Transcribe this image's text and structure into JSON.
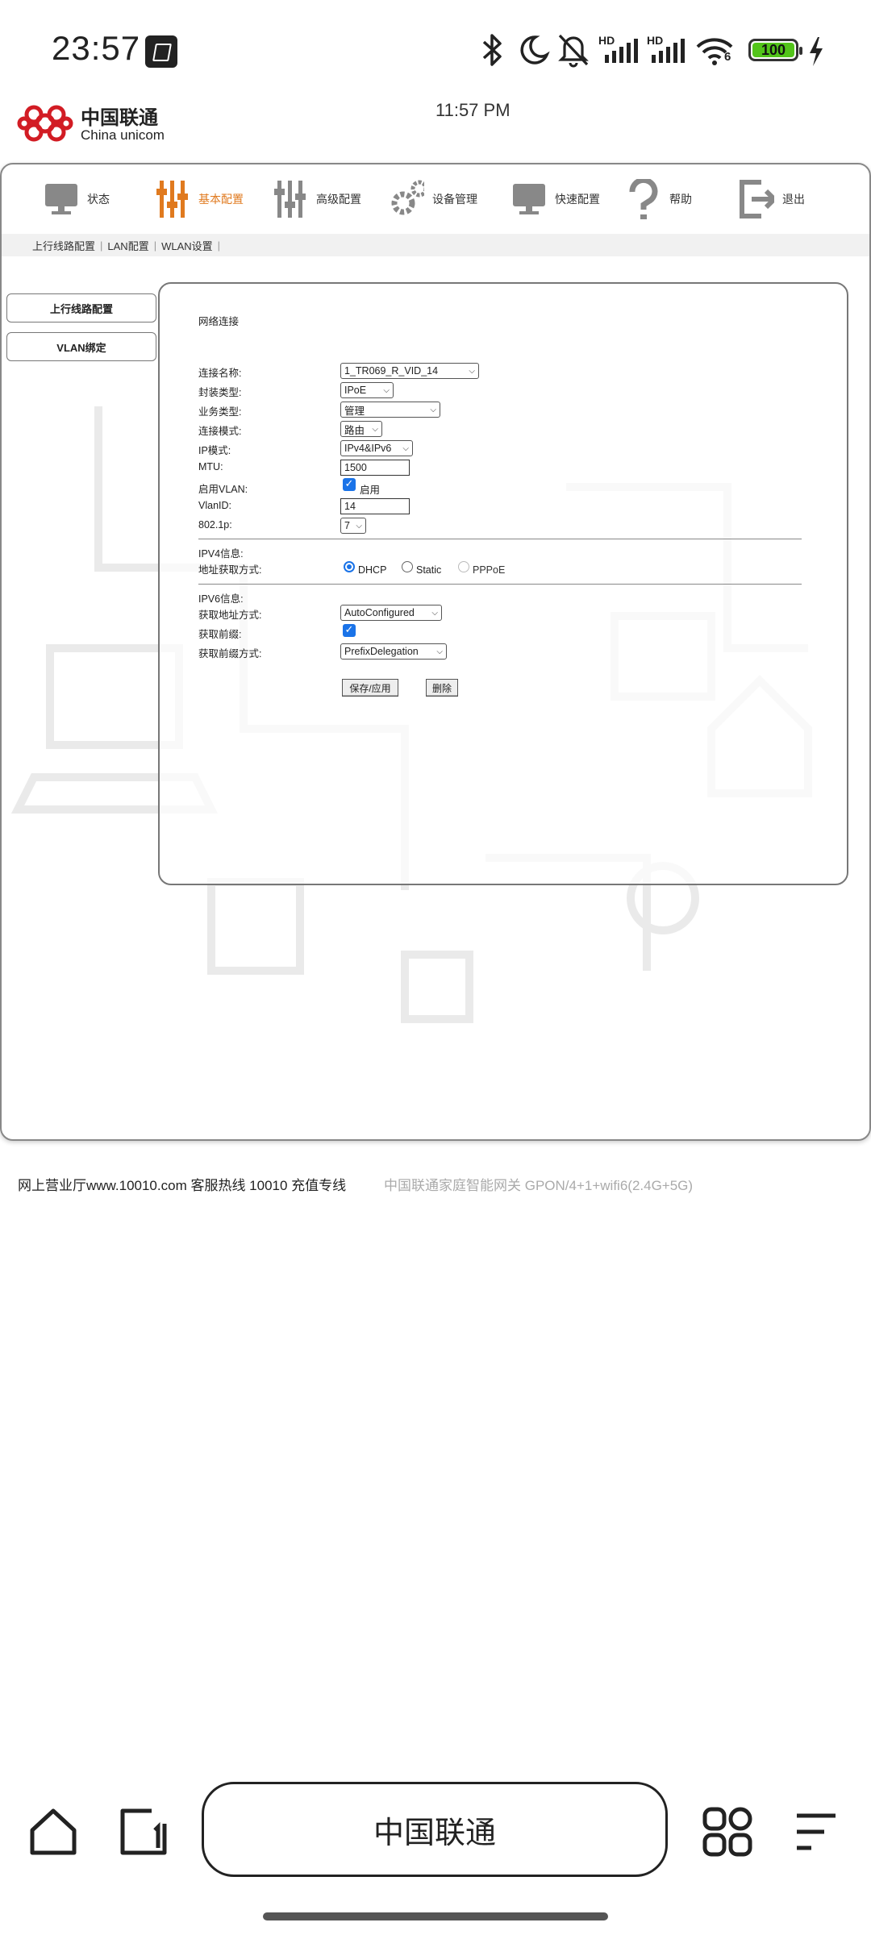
{
  "status_bar": {
    "time": "23:57",
    "battery": "100",
    "network_labels": [
      "HD",
      "HD"
    ],
    "wifi_label": "6"
  },
  "browser": {
    "logo_cn": "中国联通",
    "logo_en": "China unicom",
    "page_time": "11:57 PM",
    "address_text": "中国联通"
  },
  "topnav": {
    "items": [
      {
        "label": "状态",
        "icon": "monitor-icon"
      },
      {
        "label": "基本配置",
        "icon": "sliders-icon",
        "active": true
      },
      {
        "label": "高级配置",
        "icon": "advanced-sliders-icon"
      },
      {
        "label": "设备管理",
        "icon": "gears-icon"
      },
      {
        "label": "快速配置",
        "icon": "monitor-icon"
      },
      {
        "label": "帮助",
        "icon": "question-icon"
      },
      {
        "label": "退出",
        "icon": "logout-icon"
      }
    ]
  },
  "subnav": {
    "items": [
      "上行线路配置",
      "LAN配置",
      "WLAN设置"
    ],
    "separator": "|"
  },
  "sidebar": {
    "items": [
      "上行线路配置",
      "VLAN绑定"
    ]
  },
  "form": {
    "section_title": "网络连接",
    "labels": {
      "conn_name": "连接名称:",
      "encap": "封装类型:",
      "service": "业务类型:",
      "conn_mode": "连接模式:",
      "ip_mode": "IP模式:",
      "mtu": "MTU:",
      "enable_vlan": "启用VLAN:",
      "vlan_id": "VlanID:",
      "dot1p": "802.1p:",
      "ipv4_info": "IPV4信息:",
      "addr_method": "地址获取方式:",
      "ipv6_info": "IPV6信息:",
      "get_addr_method": "获取地址方式:",
      "get_prefix": "获取前缀:",
      "get_prefix_method": "获取前缀方式:"
    },
    "values": {
      "conn_name": "1_TR069_R_VID_14",
      "encap": "IPoE",
      "service": "管理",
      "conn_mode": "路由",
      "ip_mode": "IPv4&IPv6",
      "mtu": "1500",
      "enable_vlan_label": "启用",
      "vlan_id": "14",
      "dot1p": "7",
      "get_addr_method": "AutoConfigured",
      "get_prefix_method": "PrefixDelegation"
    },
    "radio_options": [
      "DHCP",
      "Static",
      "PPPoE"
    ],
    "selected_radio": "DHCP",
    "buttons": {
      "save": "保存/应用",
      "delete": "删除"
    }
  },
  "footer": {
    "left": "网上营业厅www.10010.com 客服热线 10010 充值专线",
    "right": "中国联通家庭智能网关 GPON/4+1+wifi6(2.4G+5G)"
  }
}
